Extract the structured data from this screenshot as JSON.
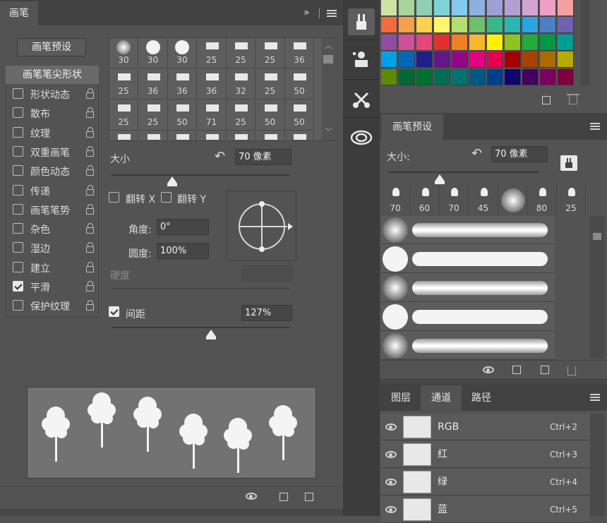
{
  "brush_panel": {
    "tab": "画笔",
    "presets_button": "画笔预设",
    "tip_shape_label": "画笔笔尖形状",
    "options": [
      {
        "label": "形状动态",
        "checked": false
      },
      {
        "label": "散布",
        "checked": false
      },
      {
        "label": "纹理",
        "checked": false
      },
      {
        "label": "双重画笔",
        "checked": false
      },
      {
        "label": "颜色动态",
        "checked": false
      },
      {
        "label": "传递",
        "checked": false
      },
      {
        "label": "画笔笔势",
        "checked": false
      },
      {
        "label": "杂色",
        "checked": false
      },
      {
        "label": "湿边",
        "checked": false
      },
      {
        "label": "建立",
        "checked": false
      },
      {
        "label": "平滑",
        "checked": true
      },
      {
        "label": "保护纹理",
        "checked": false
      }
    ],
    "brush_sizes": [
      "30",
      "30",
      "30",
      "25",
      "25",
      "25",
      "36",
      "25",
      "36",
      "36",
      "36",
      "32",
      "25",
      "50",
      "25",
      "25",
      "50",
      "71",
      "25",
      "50",
      "50"
    ],
    "size_label": "大小",
    "size_value": "70 像素",
    "flip_x": "翻转 X",
    "flip_y": "翻转 Y",
    "angle_label": "角度:",
    "angle_value": "0°",
    "roundness_label": "圆度:",
    "roundness_value": "100%",
    "hardness_label": "硬度",
    "spacing_label": "间距",
    "spacing_value": "127%",
    "spacing_checked": true
  },
  "side_toolbar": {
    "icons": [
      "brush-preset-icon",
      "clone-source-icon",
      "tool-presets-icon",
      "creative-cloud-icon"
    ]
  },
  "swatches": {
    "colors": [
      [
        "#cde3a4",
        "#a8d59a",
        "#8fd0b0",
        "#7fd3d4",
        "#86c9ef",
        "#8eb0de",
        "#9f9fd6",
        "#b59fd1",
        "#d3a3d2",
        "#f09fc4",
        "#f4a0a0"
      ],
      [
        "#f26b3a",
        "#f7a04b",
        "#fbd24d",
        "#fff56c",
        "#b4de6d",
        "#6cc06a",
        "#36b88a",
        "#29b6b4",
        "#29a6e1",
        "#4b7fc8",
        "#6f63b1"
      ],
      [
        "#8f4da3",
        "#d04f9a",
        "#e7467a",
        "#e32f2f",
        "#f07f25",
        "#f8b62d",
        "#fff100",
        "#8fc31f",
        "#22ac38",
        "#009944",
        "#009e96"
      ],
      [
        "#00a0e9",
        "#0068b7",
        "#1d2088",
        "#601986",
        "#920783",
        "#e4007f",
        "#e5004f",
        "#a40000",
        "#a84200",
        "#ac6a00",
        "#b7aa00"
      ],
      [
        "#5c8a00",
        "#006934",
        "#007130",
        "#006e54",
        "#00736d",
        "#005982",
        "#003f8e",
        "#0f0470",
        "#440062",
        "#7d0061",
        "#7f0040"
      ]
    ]
  },
  "brush_presets_panel": {
    "tab": "画笔预设",
    "size_label": "大小:",
    "size_value": "70 像素",
    "sizes": [
      "70",
      "60",
      "70",
      "45",
      "",
      "80",
      "25"
    ]
  },
  "layers_panel": {
    "tabs": [
      "图层",
      "通道",
      "路径"
    ],
    "active_tab": "通道",
    "channels": [
      {
        "name": "RGB",
        "shortcut": "Ctrl+2"
      },
      {
        "name": "红",
        "shortcut": "Ctrl+3"
      },
      {
        "name": "绿",
        "shortcut": "Ctrl+4"
      },
      {
        "name": "蓝",
        "shortcut": "Ctrl+5"
      }
    ]
  }
}
